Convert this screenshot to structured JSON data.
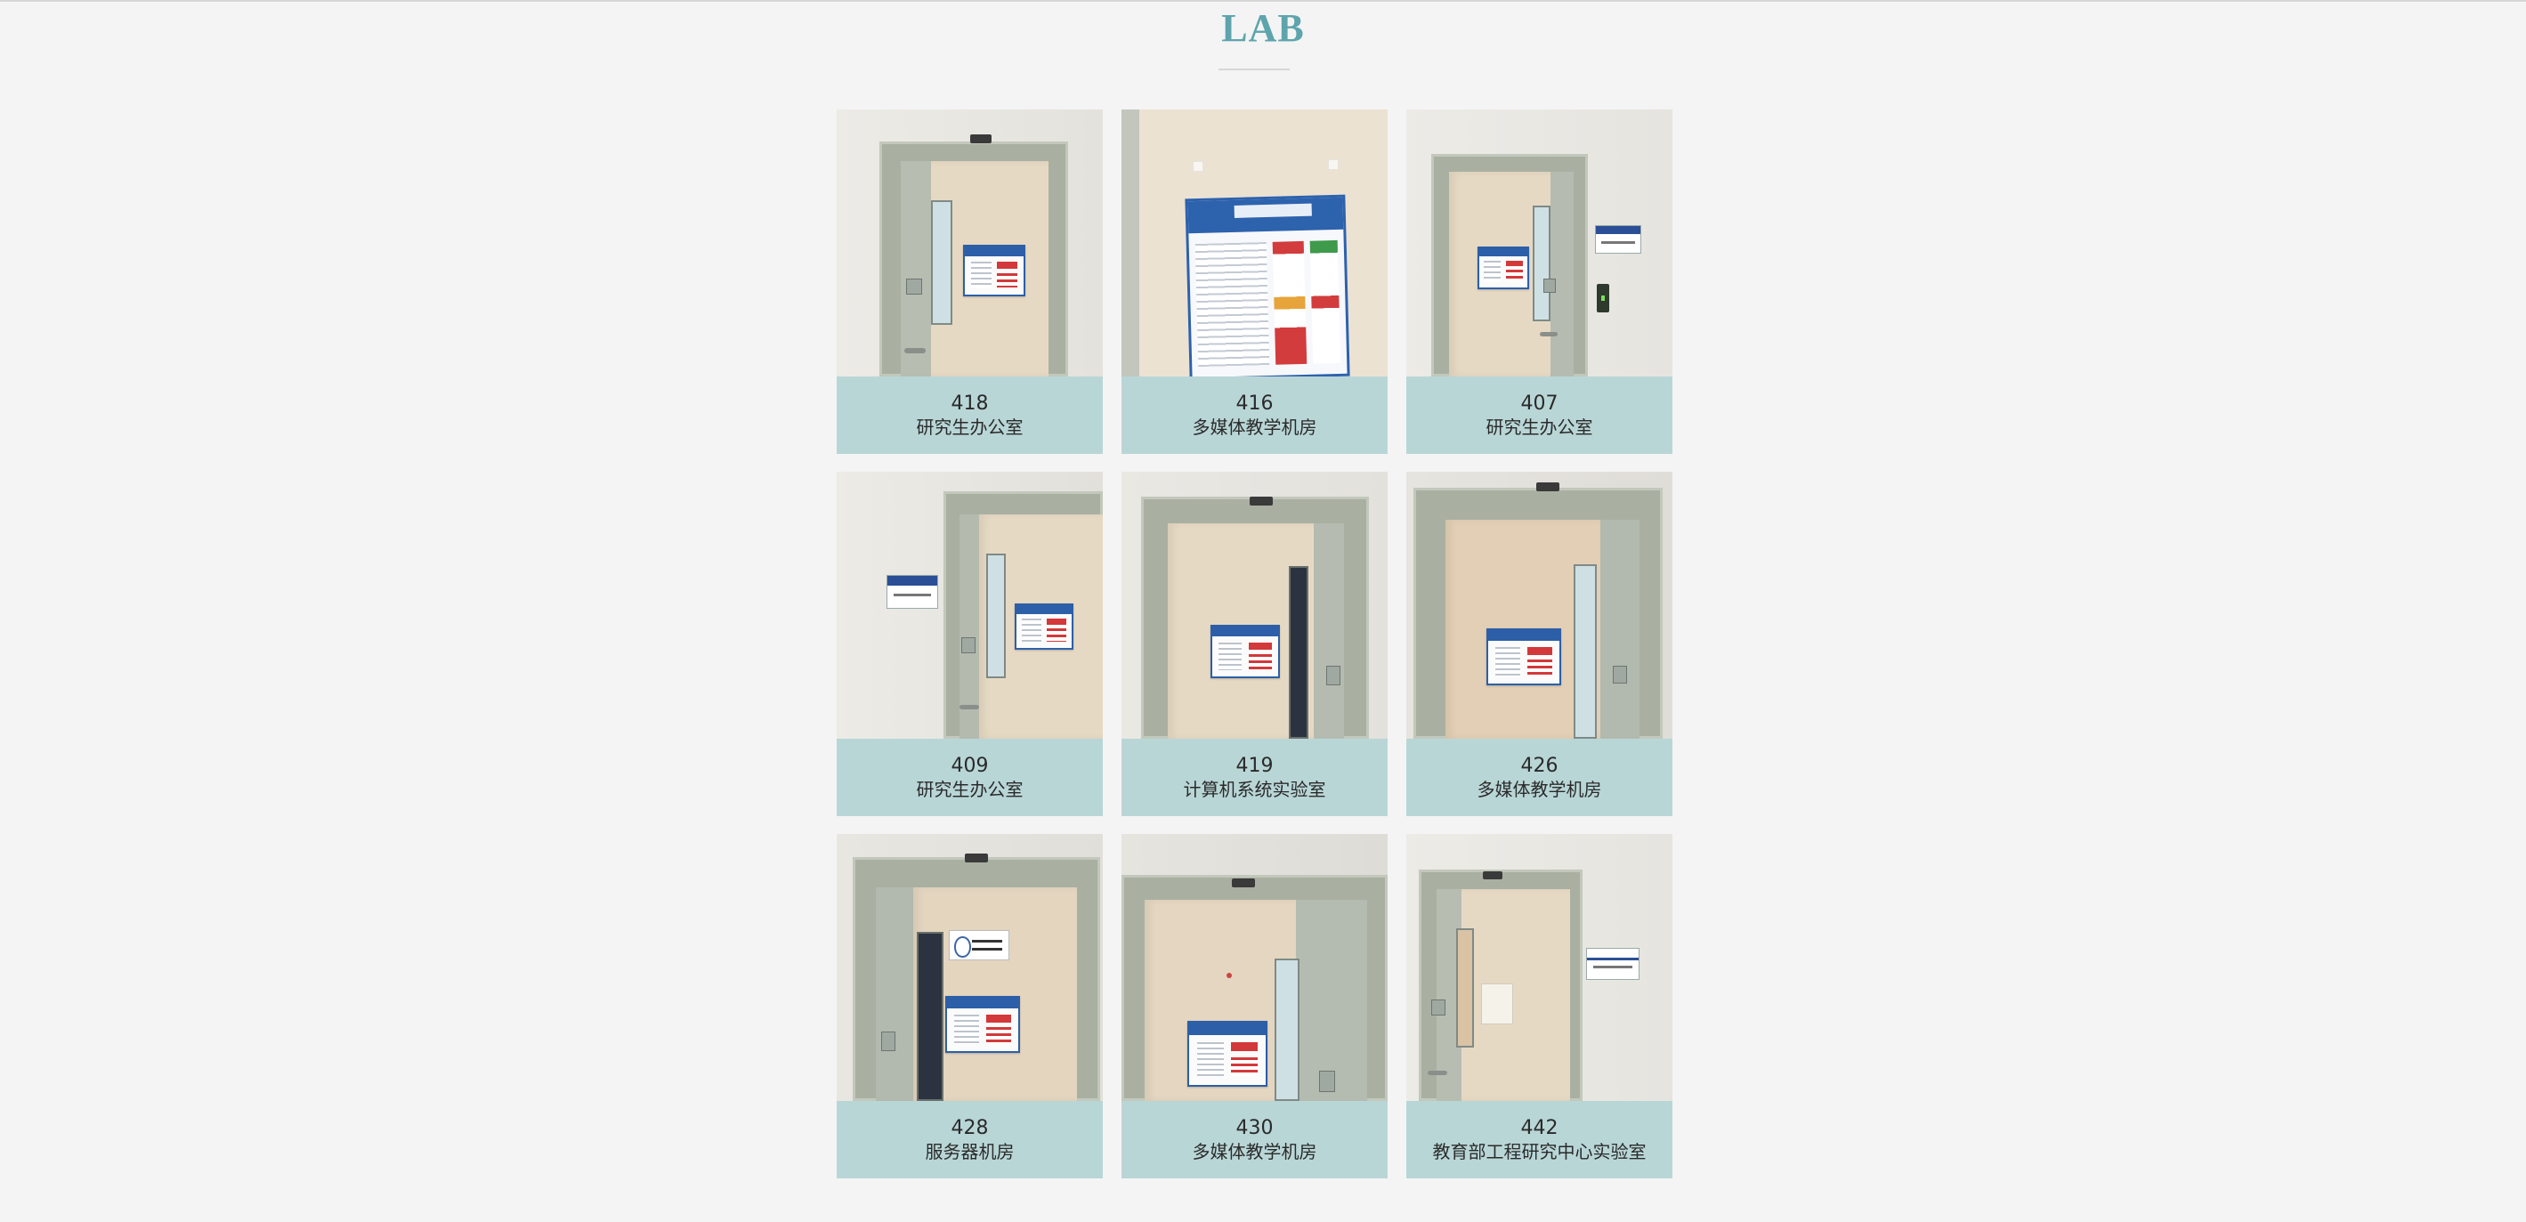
{
  "page": {
    "title": "LAB"
  },
  "rooms": [
    {
      "number": "418",
      "name": "研究生办公室"
    },
    {
      "number": "416",
      "name": "多媒体教学机房"
    },
    {
      "number": "407",
      "name": "研究生办公室"
    },
    {
      "number": "409",
      "name": "研究生办公室"
    },
    {
      "number": "419",
      "name": "计算机系统实验室"
    },
    {
      "number": "426",
      "name": "多媒体教学机房"
    },
    {
      "number": "428",
      "name": "服务器机房"
    },
    {
      "number": "430",
      "name": "多媒体教学机房"
    },
    {
      "number": "442",
      "name": "教育部工程研究中心实验室"
    }
  ],
  "colors": {
    "title": "#5ea4ad",
    "caption_bg": "#b9d6d7",
    "page_bg": "#f4f4f4"
  }
}
